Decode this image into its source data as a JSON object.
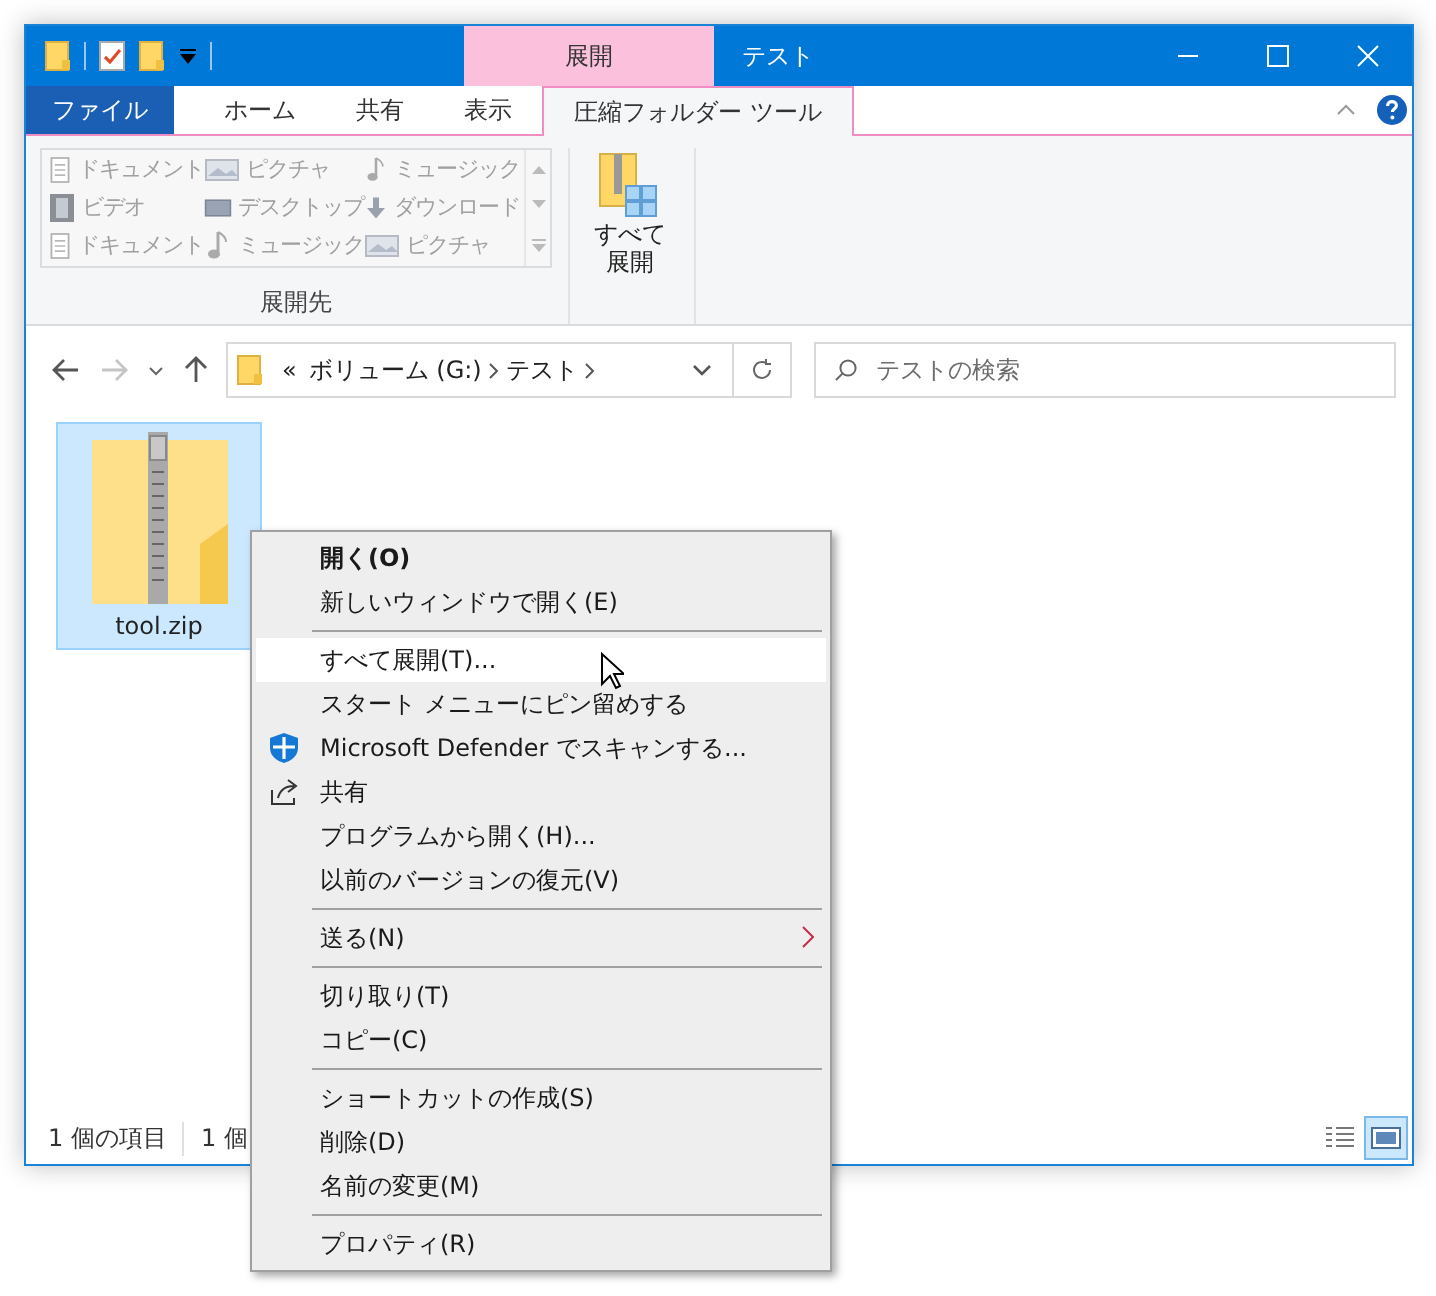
{
  "window": {
    "title": "テスト"
  },
  "context_tab": {
    "label": "展開"
  },
  "tabs": [
    {
      "label": "ファイル",
      "kind": "file",
      "selected": false
    },
    {
      "label": "ホーム",
      "kind": "tab",
      "selected": false
    },
    {
      "label": "共有",
      "kind": "tab",
      "selected": false
    },
    {
      "label": "表示",
      "kind": "tab",
      "selected": false
    },
    {
      "label": "圧縮フォルダー ツール",
      "kind": "tab",
      "selected": true
    }
  ],
  "ribbon": {
    "gallery": [
      {
        "label": "ドキュメント",
        "kind": "document",
        "disabled": true
      },
      {
        "label": "ピクチャ",
        "kind": "picture",
        "disabled": true
      },
      {
        "label": "ミュージック",
        "kind": "music",
        "disabled": true
      },
      {
        "label": "ビデオ",
        "kind": "video",
        "disabled": true
      },
      {
        "label": "デスクトップ",
        "kind": "desktop",
        "disabled": true
      },
      {
        "label": "ダウンロード",
        "kind": "download",
        "disabled": true
      },
      {
        "label": "ドキュメント",
        "kind": "document",
        "disabled": true
      },
      {
        "label": "ミュージック",
        "kind": "music",
        "disabled": true
      },
      {
        "label": "ピクチャ",
        "kind": "picture",
        "disabled": true
      }
    ],
    "group_label": "展開先",
    "extract_button": "すべて展開"
  },
  "address_bar": {
    "overflow": "«",
    "segments": [
      "ボリューム (G:)",
      "テスト"
    ]
  },
  "search": {
    "placeholder": "テストの検索"
  },
  "files": [
    {
      "name": "tool.zip",
      "selected": true
    }
  ],
  "status_bar": {
    "items": [
      "1 個の項目",
      "1 個"
    ]
  },
  "view_buttons": [
    {
      "kind": "details",
      "selected": false
    },
    {
      "kind": "large_icons",
      "selected": true
    }
  ],
  "context_menu": [
    {
      "kind": "item",
      "label": "開く(O)",
      "default": true,
      "highlighted": false
    },
    {
      "kind": "item",
      "label": "新しいウィンドウで開く(E)",
      "default": false,
      "highlighted": false
    },
    {
      "kind": "separator"
    },
    {
      "kind": "item",
      "label": "すべて展開(T)...",
      "default": false,
      "highlighted": true
    },
    {
      "kind": "item",
      "label": "スタート メニューにピン留めする",
      "default": false,
      "highlighted": false
    },
    {
      "kind": "scan",
      "label": "Microsoft Defender でスキャンする...",
      "default": false,
      "highlighted": false
    },
    {
      "kind": "share",
      "label": "共有",
      "default": false,
      "highlighted": false
    },
    {
      "kind": "item",
      "label": "プログラムから開く(H)...",
      "default": false,
      "highlighted": false
    },
    {
      "kind": "item",
      "label": "以前のバージョンの復元(V)",
      "default": false,
      "highlighted": false
    },
    {
      "kind": "separator"
    },
    {
      "kind": "submenu",
      "label": "送る(N)",
      "default": false,
      "highlighted": false
    },
    {
      "kind": "separator"
    },
    {
      "kind": "item",
      "label": "切り取り(T)",
      "default": false,
      "highlighted": false
    },
    {
      "kind": "item",
      "label": "コピー(C)",
      "default": false,
      "highlighted": false
    },
    {
      "kind": "separator"
    },
    {
      "kind": "item",
      "label": "ショートカットの作成(S)",
      "default": false,
      "highlighted": false
    },
    {
      "kind": "item",
      "label": "削除(D)",
      "default": false,
      "highlighted": false
    },
    {
      "kind": "item",
      "label": "名前の変更(M)",
      "default": false,
      "highlighted": false
    },
    {
      "kind": "separator"
    },
    {
      "kind": "item",
      "label": "プロパティ(R)",
      "default": false,
      "highlighted": false
    }
  ]
}
